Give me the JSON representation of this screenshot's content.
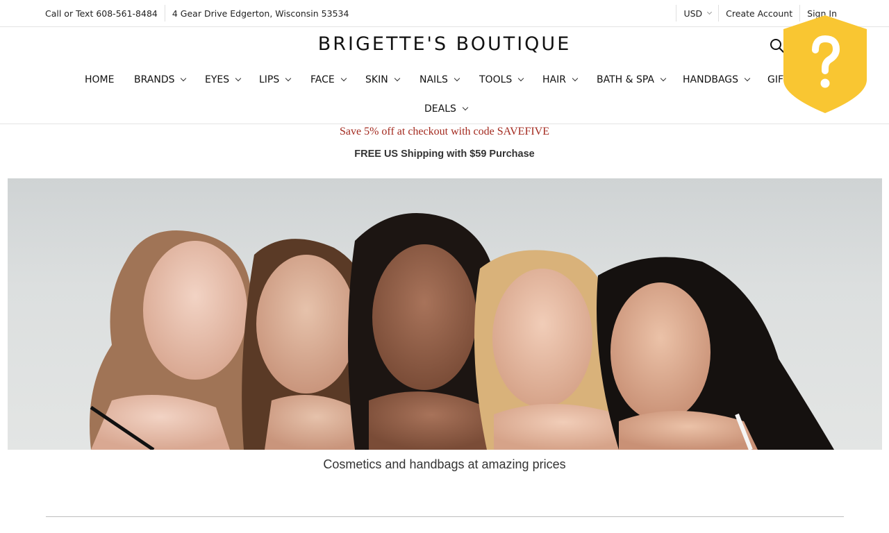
{
  "topbar": {
    "phone_text": "Call or Text 608-561-8484",
    "address": "4 Gear Drive Edgerton, Wisconsin 53534",
    "currency": "USD",
    "create_account": "Create Account",
    "sign_in": "Sign In"
  },
  "header": {
    "logo": "BRIGETTE'S BOUTIQUE"
  },
  "nav": {
    "items": [
      {
        "label": "HOME"
      },
      {
        "label": "BRANDS"
      },
      {
        "label": "EYES"
      },
      {
        "label": "LIPS"
      },
      {
        "label": "FACE"
      },
      {
        "label": "SKIN"
      },
      {
        "label": "NAILS"
      },
      {
        "label": "TOOLS"
      },
      {
        "label": "HAIR"
      },
      {
        "label": "BATH & SPA"
      },
      {
        "label": "HANDBAGS"
      },
      {
        "label": "GIFT"
      },
      {
        "label": "DEALS"
      }
    ]
  },
  "promos": {
    "code_message": "Save 5% off at checkout with code SAVEFIVE",
    "shipping_message": "FREE US Shipping with $59 Purchase"
  },
  "hero": {
    "caption": "Cosmetics and handbags at amazing prices"
  },
  "badge": {
    "icon": "question-shield-icon",
    "color": "#f9c632"
  },
  "colors": {
    "promo_red": "#a32a1f",
    "text_dark": "#111111"
  }
}
